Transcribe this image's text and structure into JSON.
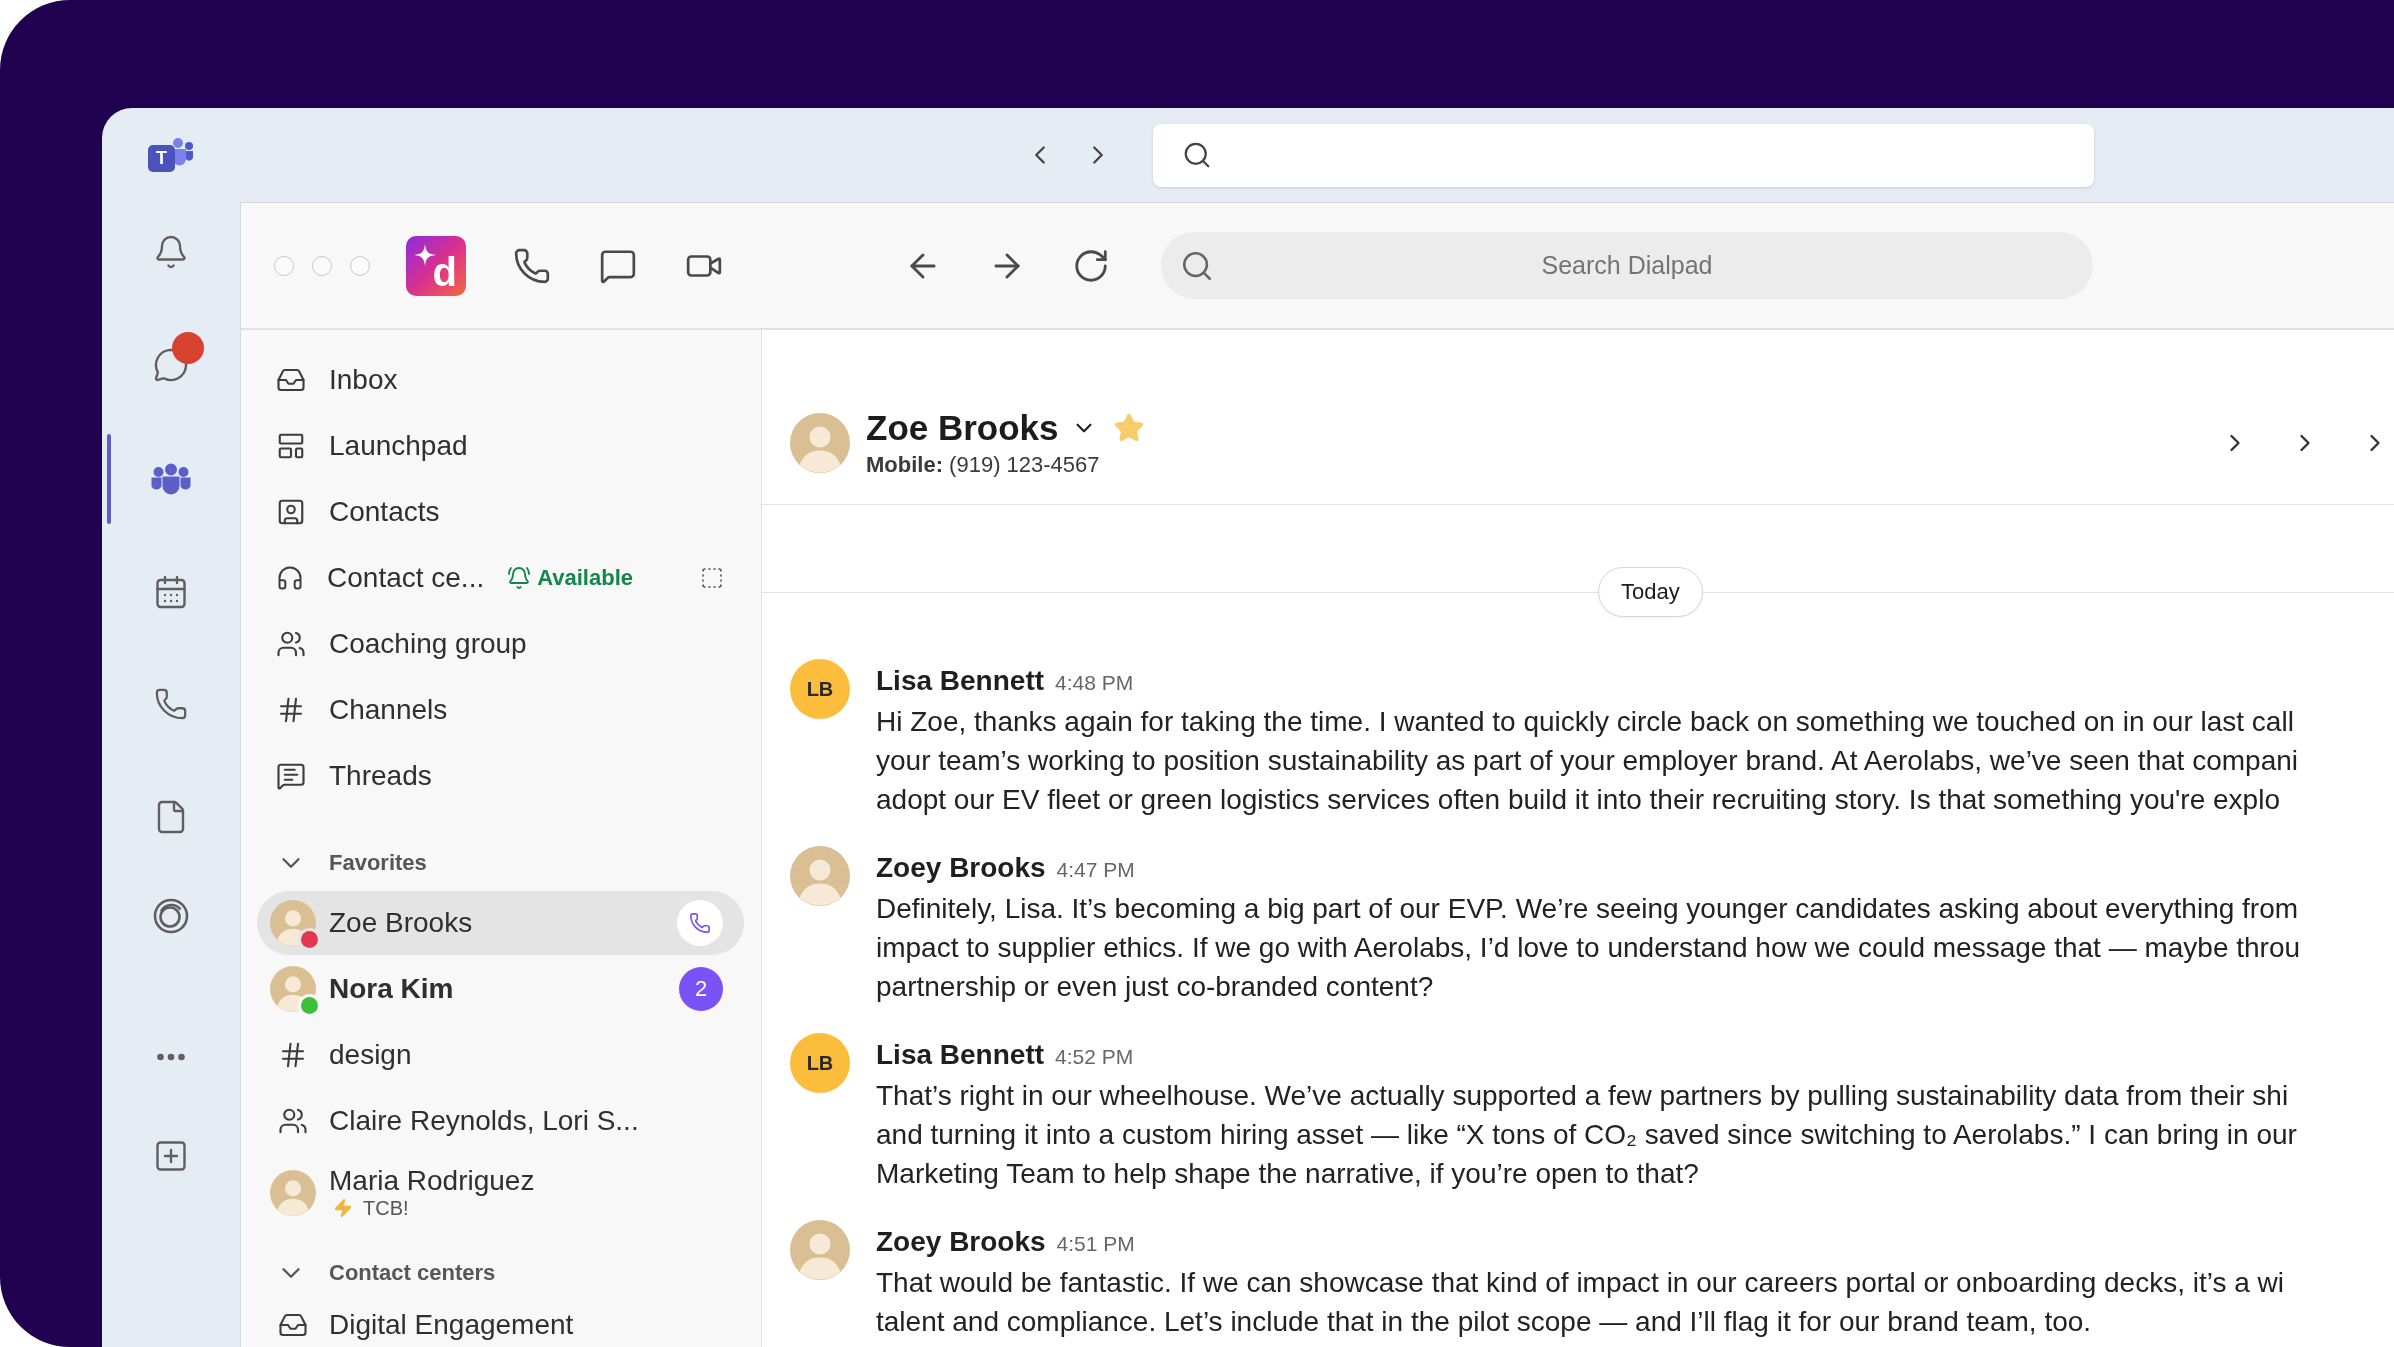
{
  "teams": {
    "logo_letter": "T",
    "rail": [
      {
        "selected": false,
        "notification": false
      },
      {
        "selected": false,
        "notification": true
      },
      {
        "selected": true,
        "notification": false
      },
      {
        "selected": false,
        "notification": false
      },
      {
        "selected": false,
        "notification": false
      },
      {
        "selected": false,
        "notification": false
      },
      {
        "selected": false,
        "notification": false
      },
      {
        "selected": false,
        "notification": false
      },
      {
        "selected": false,
        "notification": false
      }
    ]
  },
  "toolbar": {
    "logo_letter": "d",
    "search": {
      "placeholder": "Search Dialpad"
    }
  },
  "sidebar": {
    "nav": [
      {
        "label": "Inbox"
      },
      {
        "label": "Launchpad"
      },
      {
        "label": "Contacts"
      },
      {
        "label": "Contact ce...",
        "status": "Available"
      },
      {
        "label": "Coaching group"
      },
      {
        "label": "Channels"
      },
      {
        "label": "Threads"
      }
    ],
    "sections": [
      {
        "title": "Favorites",
        "expanded": true,
        "items": [
          {
            "kind": "contact",
            "label": "Zoe Brooks",
            "selected": true,
            "unread": false,
            "color": "#e5364f"
          },
          {
            "kind": "contact",
            "label": "Nora Kim",
            "selected": false,
            "unread": true,
            "color": "#3dbf3a",
            "badge": "2"
          },
          {
            "kind": "channel",
            "label": "design",
            "selected": false,
            "unread": false
          },
          {
            "kind": "group",
            "label": "Claire Reynolds, Lori S...",
            "selected": false,
            "unread": false
          },
          {
            "kind": "contact",
            "label": "Maria Rodriguez",
            "subtitle": "TCB!",
            "selected": false,
            "unread": false
          }
        ]
      },
      {
        "title": "Contact centers",
        "expanded": true,
        "items": [
          {
            "kind": "inbox",
            "label": "Digital Engagement",
            "selected": false,
            "unread": false
          }
        ]
      }
    ]
  },
  "conversation": {
    "name": "Zoe Brooks",
    "starred": true,
    "phone": "**Mobile:** (919) 123-4567",
    "divider": "Today",
    "messages": [
      {
        "kind": "initials",
        "initials": "LB",
        "sender": "Lisa Bennett",
        "time": "4:48 PM",
        "lines": [
          "Hi Zoe, thanks again for taking the time. I wanted to quickly circle back on something we touched on in our last call",
          "your team’s working to position sustainability as part of your employer brand. At Aerolabs, we’ve seen that compani",
          "adopt our EV fleet or green logistics services often build it into their recruiting story. Is that something you're explo"
        ]
      },
      {
        "kind": "photo",
        "sender": "Zoey Brooks",
        "time": "4:47 PM",
        "lines": [
          "Definitely, Lisa. It’s becoming a big part of our EVP. We’re seeing younger candidates asking about everything from",
          "impact to supplier ethics. If we go with Aerolabs, I’d love to understand how we could message that — maybe throu",
          "partnership or even just co-branded content?"
        ]
      },
      {
        "kind": "initials",
        "initials": "LB",
        "sender": "Lisa Bennett",
        "time": "4:52 PM",
        "lines": [
          "That’s right in our wheelhouse. We’ve actually supported a few partners by pulling sustainability data from their shi",
          "and turning it into a custom hiring asset — like “X tons of CO₂ saved since switching to Aerolabs.” I can bring in our",
          "Marketing Team to help shape the narrative, if you’re open to that?"
        ]
      },
      {
        "kind": "photo",
        "sender": "Zoey Brooks",
        "time": "4:51 PM",
        "lines": [
          "That would be fantastic. If we can showcase that kind of impact in our careers portal or onboarding decks, it’s a wi",
          "talent and compliance. Let’s include that in the pilot scope — and I’ll flag it for our brand team, too."
        ]
      }
    ]
  }
}
